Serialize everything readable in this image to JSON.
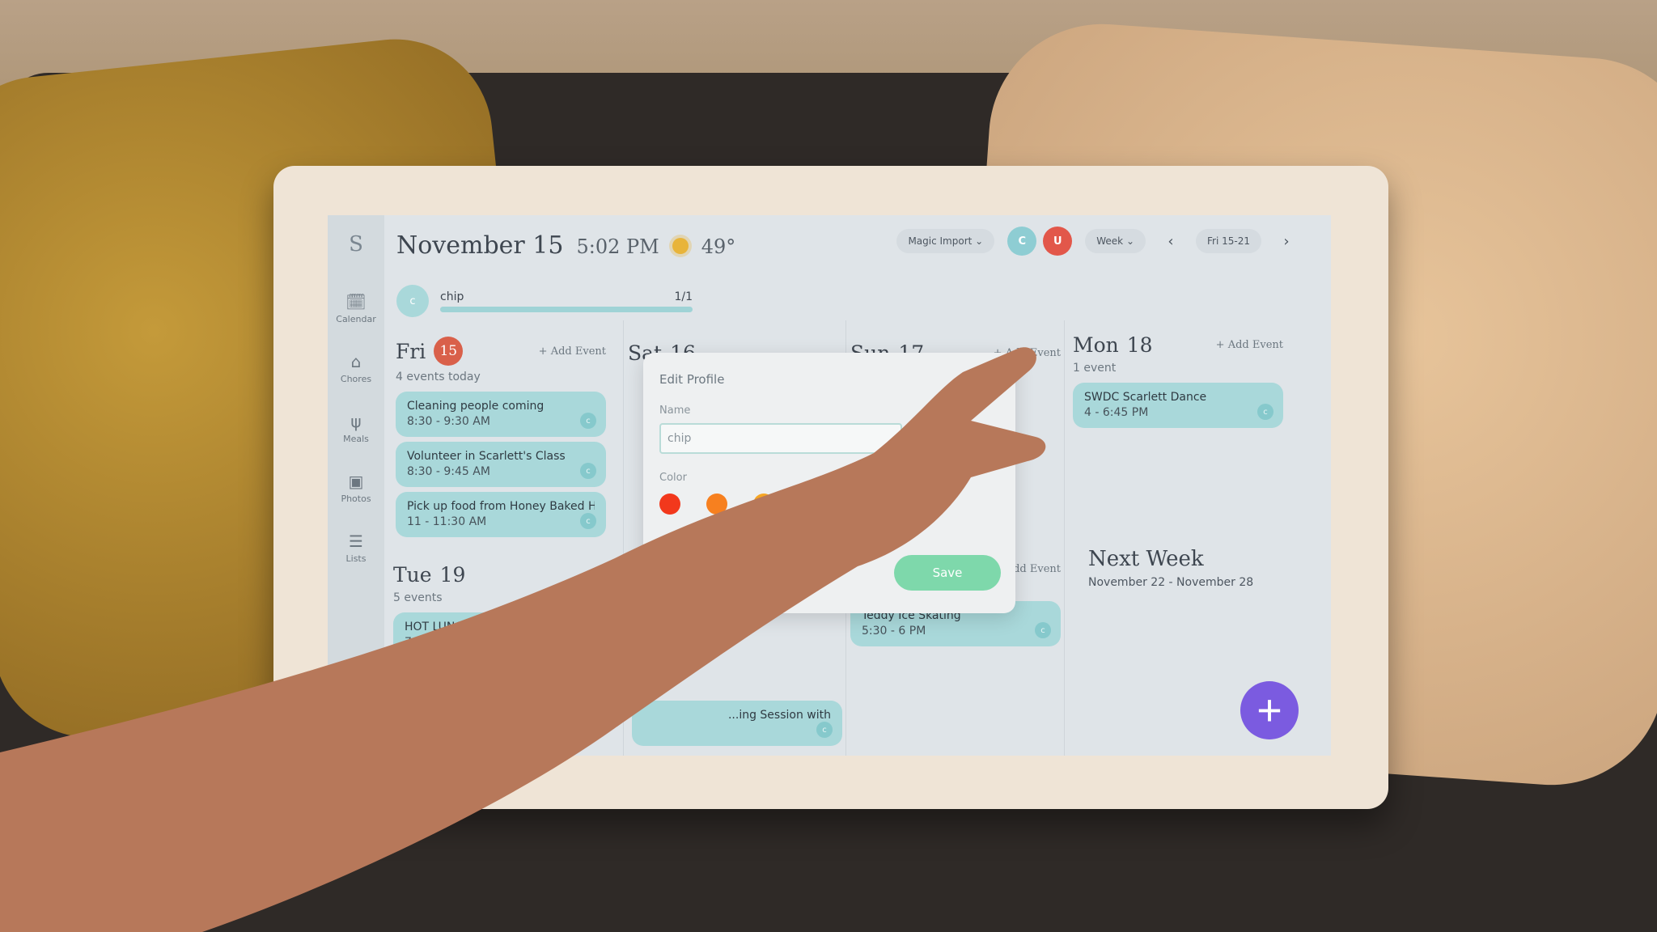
{
  "sidebar": {
    "logo": "S",
    "items": [
      {
        "label": "Calendar",
        "icon": "calendar-icon"
      },
      {
        "label": "Chores",
        "icon": "broom-icon"
      },
      {
        "label": "Meals",
        "icon": "utensils-icon"
      },
      {
        "label": "Photos",
        "icon": "image-icon"
      },
      {
        "label": "Lists",
        "icon": "list-icon"
      }
    ]
  },
  "header": {
    "date": "November 15",
    "time": "5:02 PM",
    "weather_icon": "sun-icon",
    "temperature": "49°",
    "magic_import": "Magic Import",
    "profiles": [
      {
        "initial": "C",
        "color": "#8ecdd3"
      },
      {
        "initial": "U",
        "color": "#e2574a"
      }
    ],
    "view": "Week",
    "range": "Fri 15-21"
  },
  "chores": {
    "avatar": "c",
    "name": "chip",
    "progress_text": "1/1",
    "progress": 1.0
  },
  "days": [
    {
      "name": "Fri",
      "num": "15",
      "add": "+ Add Event",
      "count": "4 events today",
      "events": [
        {
          "title": "Cleaning people coming",
          "time": "8:30 - 9:30 AM"
        },
        {
          "title": "Volunteer in Scarlett's Class",
          "time": "8:30 - 9:45 AM"
        },
        {
          "title": "Pick up food from Honey Baked H",
          "time": "11 - 11:30 AM"
        }
      ]
    },
    {
      "name": "Sat",
      "num": "16"
    },
    {
      "name": "Sun",
      "num": "17",
      "add": "+ Add Event"
    },
    {
      "name": "Mon",
      "num": "18",
      "add": "+ Add Event",
      "count": "1 event",
      "events": [
        {
          "title": "SWDC Scarlett Dance",
          "time": "4 - 6:45 PM"
        }
      ]
    },
    {
      "name": "Tue",
      "num": "19",
      "count": "5 events",
      "events": [
        {
          "title": "HOT LUNCH",
          "time": "7"
        }
      ]
    }
  ],
  "wed": {
    "events": [
      {
        "title": "...ing Session with"
      }
    ]
  },
  "thu": {
    "add": "Add Event",
    "events": [
      {
        "title": "Teddy Ice Skating",
        "time": "5:30 - 6 PM"
      }
    ]
  },
  "event_avatar": "c",
  "next_week": {
    "title": "Next Week",
    "range": "November 22 - November 28"
  },
  "modal": {
    "title": "Edit Profile",
    "name_label": "Name",
    "name_value": "chip",
    "color_label": "Color",
    "colors": [
      "#f2381c",
      "#f7801f",
      "#f6a623"
    ],
    "save": "Save"
  },
  "fab": "+"
}
